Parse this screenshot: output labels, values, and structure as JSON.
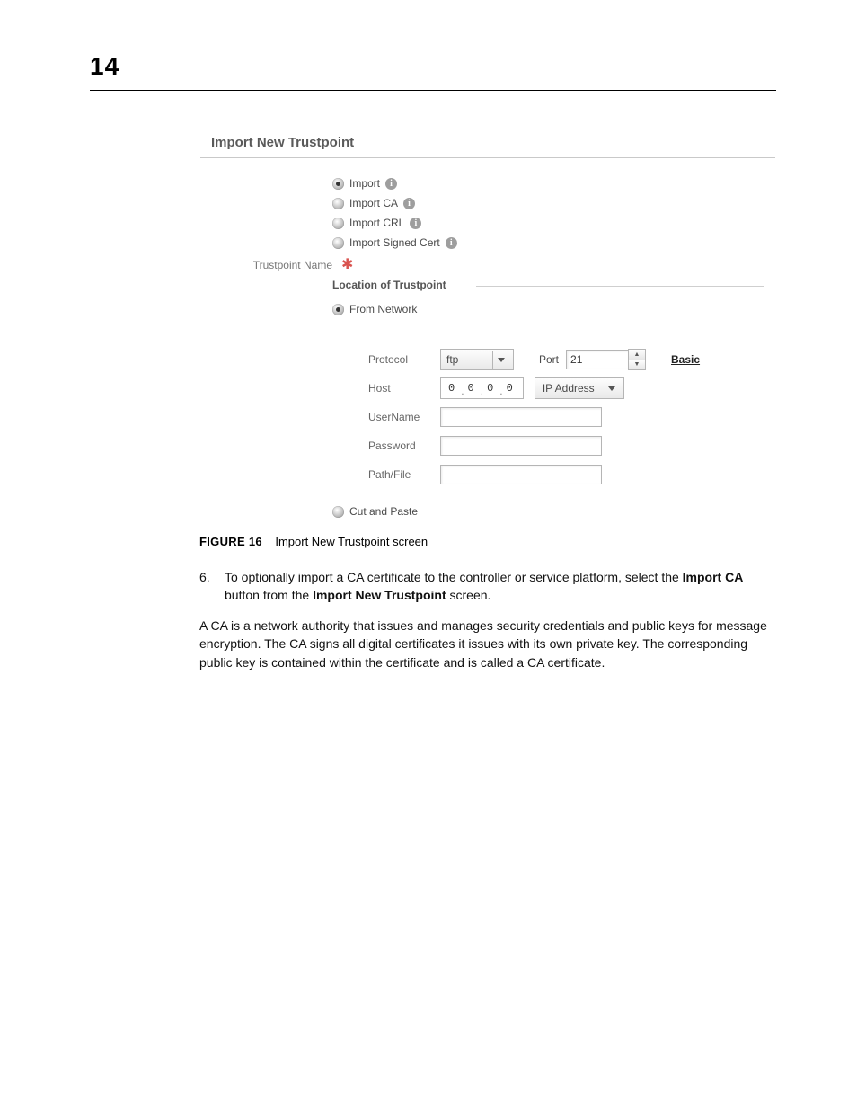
{
  "page": {
    "number": "14"
  },
  "screenshot": {
    "title": "Import New Trustpoint",
    "radios": {
      "import": "Import",
      "import_ca": "Import CA",
      "import_crl": "Import CRL",
      "import_signed": "Import Signed Cert"
    },
    "trustpoint_name_label": "Trustpoint Name",
    "location_legend": "Location of Trustpoint",
    "from_network": "From Network",
    "protocol_label": "Protocol",
    "protocol_value": "ftp",
    "port_label": "Port",
    "port_value": "21",
    "basic_link": "Basic",
    "host_label": "Host",
    "ip_octets": [
      "0",
      "0",
      "0",
      "0"
    ],
    "ip_type": "IP Address",
    "username_label": "UserName",
    "password_label": "Password",
    "pathfile_label": "Path/File",
    "cut_and_paste": "Cut and Paste"
  },
  "caption": {
    "label": "FIGURE 16",
    "text": "Import New Trustpoint screen"
  },
  "step6": {
    "num": "6.",
    "pre": "To optionally import a CA certificate to the controller or service platform, select the ",
    "bold1": "Import CA",
    "mid": " button from the ",
    "bold2": "Import New Trustpoint",
    "post": " screen."
  },
  "para2": "A CA is a network authority that issues and manages security credentials and public keys for message encryption. The CA signs all digital certificates it issues with its own private key. The corresponding public key is contained within the certificate and is called a CA certificate."
}
